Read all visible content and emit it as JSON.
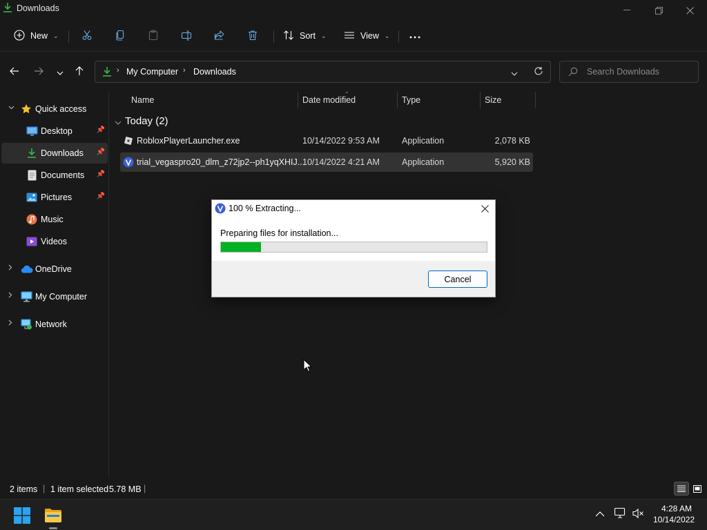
{
  "window": {
    "title": "Downloads"
  },
  "toolbar": {
    "new_label": "New",
    "sort_label": "Sort",
    "view_label": "View"
  },
  "address": {
    "segments": [
      "My Computer",
      "Downloads"
    ]
  },
  "search": {
    "placeholder": "Search Downloads"
  },
  "sidebar": {
    "items": [
      {
        "label": "Quick access",
        "icon": "star-icon"
      },
      {
        "label": "Desktop",
        "icon": "desktop-icon"
      },
      {
        "label": "Downloads",
        "icon": "download-icon"
      },
      {
        "label": "Documents",
        "icon": "document-icon"
      },
      {
        "label": "Pictures",
        "icon": "pictures-icon"
      },
      {
        "label": "Music",
        "icon": "music-icon"
      },
      {
        "label": "Videos",
        "icon": "videos-icon"
      },
      {
        "label": "OneDrive",
        "icon": "cloud-icon"
      },
      {
        "label": "My Computer",
        "icon": "computer-icon"
      },
      {
        "label": "Network",
        "icon": "network-icon"
      }
    ]
  },
  "filelist": {
    "columns": [
      "Name",
      "Date modified",
      "Type",
      "Size"
    ],
    "group_label": "Today (2)",
    "rows": [
      {
        "name": "RobloxPlayerLauncher.exe",
        "date": "10/14/2022 9:53 AM",
        "type": "Application",
        "size": "2,078 KB"
      },
      {
        "name": "trial_vegaspro20_dlm_z72jp2--ph1yqXHIJ...",
        "date": "10/14/2022 4:21 AM",
        "type": "Application",
        "size": "5,920 KB"
      }
    ]
  },
  "dialog": {
    "title": "100 % Extracting...",
    "message": "Preparing files for installation...",
    "progress": 0.15,
    "cancel_label": "Cancel"
  },
  "status": {
    "count": "2 items",
    "selected": "1 item selected",
    "size": "5.78 MB"
  },
  "taskbar": {
    "time": "4:28 AM",
    "date": "10/14/2022"
  },
  "colors": {
    "accent": "#0067c0",
    "progress": "#06b025",
    "download_green": "#3bb54a"
  }
}
